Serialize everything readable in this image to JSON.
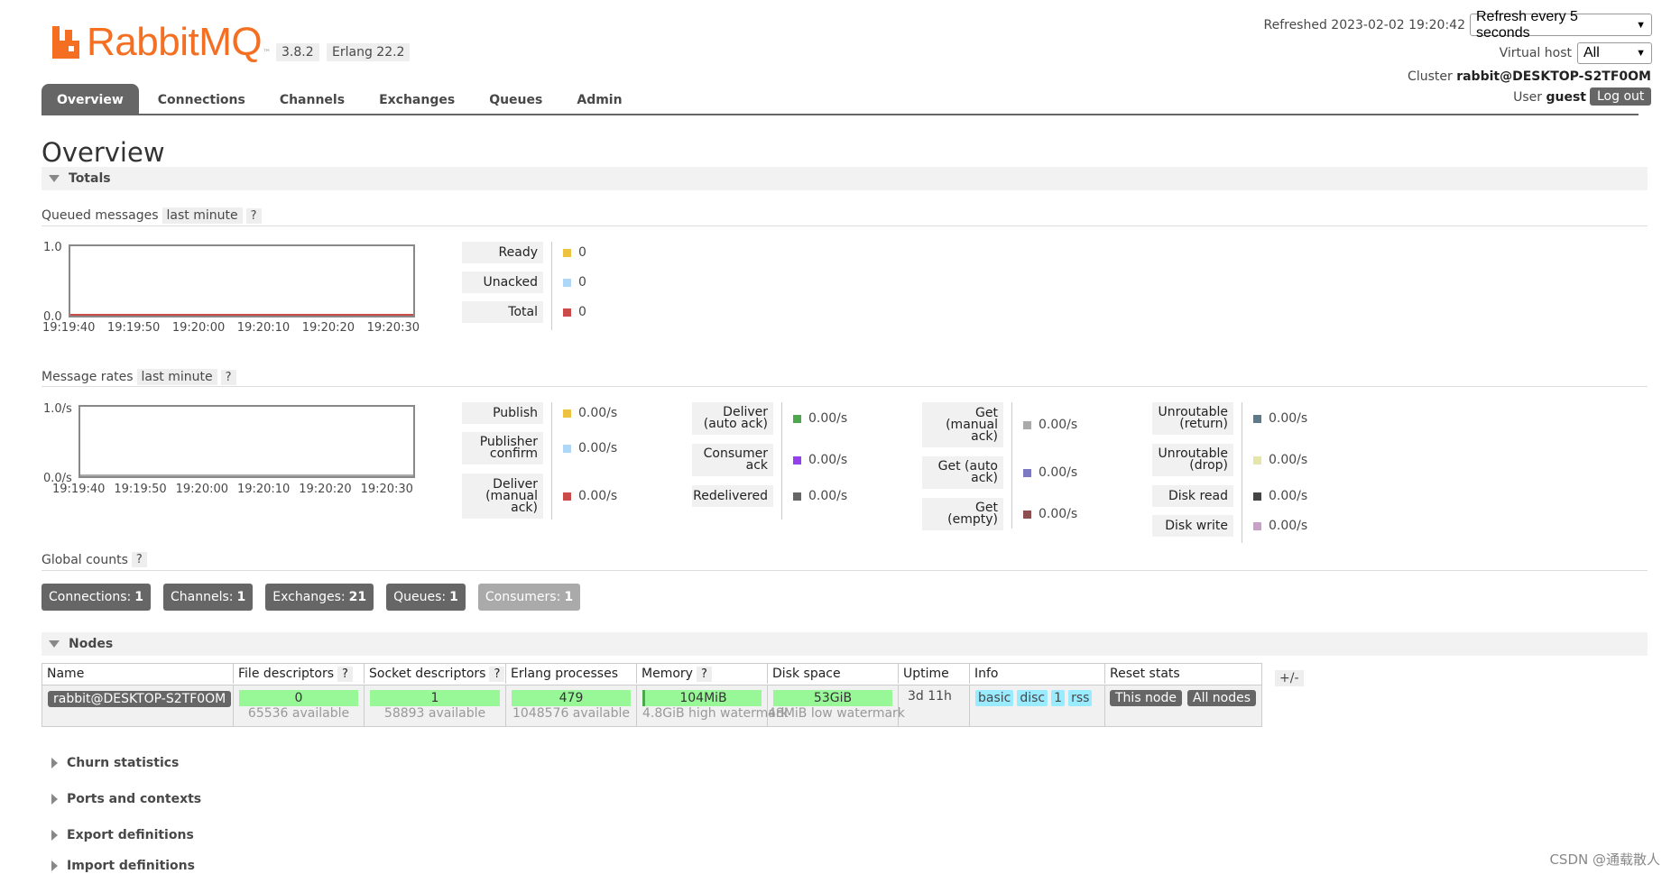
{
  "header": {
    "brand_prefix": "Rabbit",
    "brand_suffix": "MQ",
    "brand_tm": "™",
    "version": "3.8.2",
    "erlang": "Erlang 22.2",
    "refreshed_label": "Refreshed 2023-02-02 19:20:42",
    "refresh_select": "Refresh every 5 seconds",
    "vhost_label": "Virtual host",
    "vhost_select": "All",
    "cluster_label": "Cluster",
    "cluster_name": "rabbit@DESKTOP-S2TF0OM",
    "user_label": "User",
    "user_name": "guest",
    "logout_label": "Log out"
  },
  "tabs": [
    "Overview",
    "Connections",
    "Channels",
    "Exchanges",
    "Queues",
    "Admin"
  ],
  "page_title": "Overview",
  "totals": {
    "section_label": "Totals",
    "queued": {
      "label": "Queued messages",
      "range": "last minute",
      "help": "?",
      "y_top": "1.0",
      "y_bottom": "0.0",
      "x_ticks": [
        "19:19:40",
        "19:19:50",
        "19:20:00",
        "19:20:10",
        "19:20:20",
        "19:20:30"
      ],
      "legend": [
        {
          "label": "Ready",
          "value": "0",
          "color": "#edc240"
        },
        {
          "label": "Unacked",
          "value": "0",
          "color": "#afd8f8"
        },
        {
          "label": "Total",
          "value": "0",
          "color": "#cb4b4b"
        }
      ]
    },
    "rates": {
      "label": "Message rates",
      "range": "last minute",
      "help": "?",
      "y_top": "1.0/s",
      "y_bottom": "0.0/s",
      "x_ticks": [
        "19:19:40",
        "19:19:50",
        "19:20:00",
        "19:20:10",
        "19:20:20",
        "19:20:30"
      ],
      "col1": [
        {
          "label": "Publish",
          "value": "0.00/s",
          "color": "#edc240"
        },
        {
          "label": "Publisher confirm",
          "value": "0.00/s",
          "color": "#afd8f8"
        },
        {
          "label": "Deliver (manual ack)",
          "value": "0.00/s",
          "color": "#cb4b4b"
        }
      ],
      "col2": [
        {
          "label": "Deliver (auto ack)",
          "value": "0.00/s",
          "color": "#4da74d"
        },
        {
          "label": "Consumer ack",
          "value": "0.00/s",
          "color": "#9440ed"
        },
        {
          "label": "Redelivered",
          "value": "0.00/s",
          "color": "#666666"
        }
      ],
      "col3": [
        {
          "label": "Get (manual ack)",
          "value": "0.00/s",
          "color": "#aaaaaa"
        },
        {
          "label": "Get (auto ack)",
          "value": "0.00/s",
          "color": "#7c79c3"
        },
        {
          "label": "Get (empty)",
          "value": "0.00/s",
          "color": "#8d4f4f"
        }
      ],
      "col4": [
        {
          "label": "Unroutable (return)",
          "value": "0.00/s",
          "color": "#5c7a8a"
        },
        {
          "label": "Unroutable (drop)",
          "value": "0.00/s",
          "color": "#e6e6a8"
        },
        {
          "label": "Disk read",
          "value": "0.00/s",
          "color": "#444444"
        },
        {
          "label": "Disk write",
          "value": "0.00/s",
          "color": "#c8a0c8"
        }
      ]
    },
    "global": {
      "label": "Global counts",
      "help": "?",
      "counts": [
        {
          "label": "Connections:",
          "value": "1"
        },
        {
          "label": "Channels:",
          "value": "1"
        },
        {
          "label": "Exchanges:",
          "value": "21"
        },
        {
          "label": "Queues:",
          "value": "1"
        },
        {
          "label": "Consumers:",
          "value": "1"
        }
      ]
    }
  },
  "nodes": {
    "section_label": "Nodes",
    "headers": [
      "Name",
      "File descriptors",
      "Socket descriptors",
      "Erlang processes",
      "Memory",
      "Disk space",
      "Uptime",
      "Info",
      "Reset stats"
    ],
    "help": "?",
    "plusminus": "+/-",
    "row": {
      "name": "rabbit@DESKTOP-S2TF0OM",
      "fd": "0",
      "fd_sub": "65536 available",
      "sd": "1",
      "sd_sub": "58893 available",
      "ep": "479",
      "ep_sub": "1048576 available",
      "mem": "104MiB",
      "mem_sub": "4.8GiB high watermark",
      "disk": "53GiB",
      "disk_sub": "48MiB low watermark",
      "uptime": "3d 11h",
      "info": [
        "basic",
        "disc",
        "1",
        "rss"
      ],
      "reset_this": "This node",
      "reset_all": "All nodes"
    }
  },
  "collapsed_sections": [
    "Churn statistics",
    "Ports and contexts",
    "Export definitions",
    "Import definitions"
  ],
  "watermark": "CSDN @通载散人"
}
